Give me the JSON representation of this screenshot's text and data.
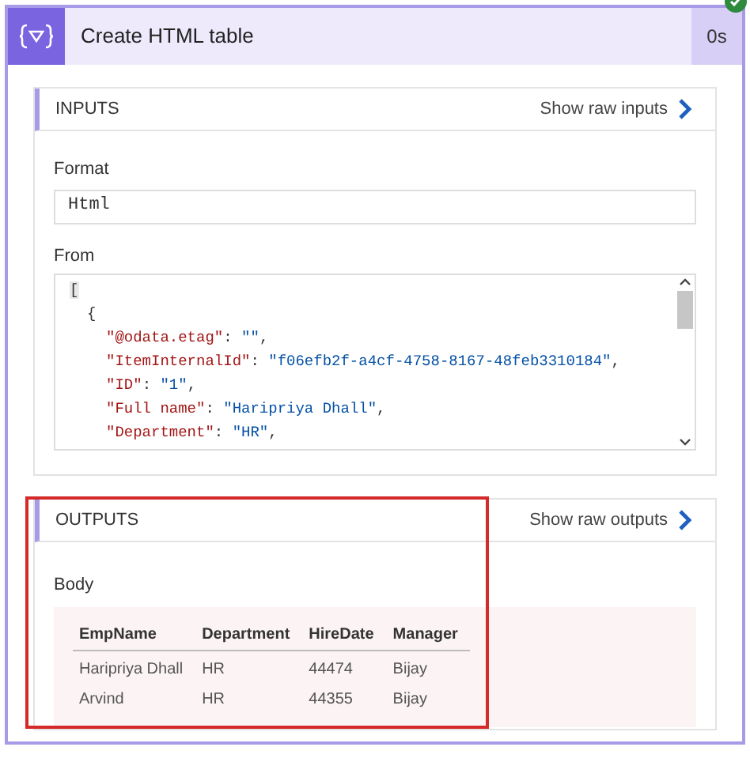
{
  "action": {
    "title": "Create HTML table",
    "duration": "0s",
    "succeeded": true
  },
  "inputs": {
    "heading": "INPUTS",
    "raw_link": "Show raw inputs",
    "format": {
      "label": "Format",
      "value": "Html"
    },
    "from": {
      "label": "From",
      "lines": [
        {
          "kind": "open_array",
          "text": "["
        },
        {
          "kind": "open_object",
          "text": "{"
        },
        {
          "kind": "pair",
          "key": "\"@odata.etag\"",
          "separator": ":",
          "value": "\"\"",
          "end": ","
        },
        {
          "kind": "pair",
          "key": "\"ItemInternalId\"",
          "separator": ":",
          "value": "\"f06efb2f-a4cf-4758-8167-48feb3310184\"",
          "end": ","
        },
        {
          "kind": "pair",
          "key": "\"ID\"",
          "separator": ":",
          "value": "\"1\"",
          "end": ","
        },
        {
          "kind": "pair",
          "key": "\"Full name\"",
          "separator": ":",
          "value": "\"Haripriya Dhall\"",
          "end": ","
        },
        {
          "kind": "pair",
          "key": "\"Department\"",
          "separator": ":",
          "value": "\"HR\"",
          "end": ","
        }
      ]
    }
  },
  "outputs": {
    "heading": "OUTPUTS",
    "raw_link": "Show raw outputs",
    "highlighted": true,
    "body": {
      "label": "Body",
      "columns": [
        "EmpName",
        "Department",
        "HireDate",
        "Manager"
      ],
      "rows": [
        [
          "Haripriya Dhall",
          "HR",
          "44474",
          "Bijay"
        ],
        [
          "Arvind",
          "HR",
          "44355",
          "Bijay"
        ]
      ]
    }
  }
}
